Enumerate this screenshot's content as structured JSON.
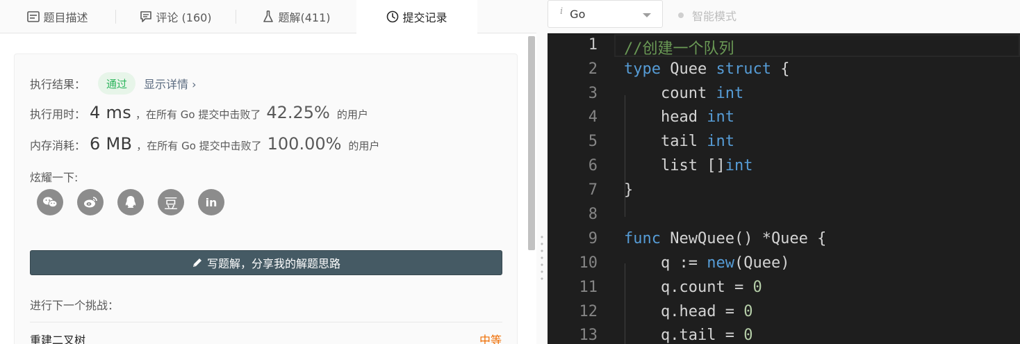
{
  "tabs": [
    {
      "label": "题目描述",
      "icon": "description-icon"
    },
    {
      "label": "评论 (160)",
      "icon": "comment-icon"
    },
    {
      "label": "题解(411)",
      "icon": "flask-icon"
    },
    {
      "label": "提交记录",
      "icon": "clock-icon",
      "active": true
    }
  ],
  "result": {
    "label": "执行结果：",
    "status": "通过",
    "detail": "显示详情 ›"
  },
  "runtime": {
    "label": "执行用时：",
    "value": "4 ms",
    "middle": "，在所有 Go 提交中击败了",
    "percent": "42.25%",
    "suffix": "的用户"
  },
  "memory": {
    "label": "内存消耗：",
    "value": "6 MB",
    "middle": "，在所有 Go 提交中击败了",
    "percent": "100.00%",
    "suffix": "的用户"
  },
  "share": {
    "label": "炫耀一下:",
    "icons": [
      "wechat-icon",
      "weibo-icon",
      "qq-icon",
      "douban-icon",
      "linkedin-icon"
    ],
    "douban_glyph": "豆",
    "linkedin_glyph": "in"
  },
  "write_solution": {
    "label": "写题解，分享我的解题思路",
    "icon": "pencil-icon"
  },
  "next_challenge": {
    "label": "进行下一个挑战：",
    "item": "重建二叉树",
    "difficulty": "中等"
  },
  "editor_toolbar": {
    "language": "Go",
    "mode_label": "智能模式"
  },
  "code_lines": [
    {
      "n": "1",
      "text": "//创建一个队列"
    },
    {
      "n": "2",
      "text": "type Quee struct {"
    },
    {
      "n": "3",
      "text": "    count int"
    },
    {
      "n": "4",
      "text": "    head int"
    },
    {
      "n": "5",
      "text": "    tail int"
    },
    {
      "n": "6",
      "text": "    list []int"
    },
    {
      "n": "7",
      "text": "}"
    },
    {
      "n": "8",
      "text": ""
    },
    {
      "n": "9",
      "text": "func NewQuee() *Quee {"
    },
    {
      "n": "10",
      "text": "    q := new(Quee)"
    },
    {
      "n": "11",
      "text": "    q.count = 0"
    },
    {
      "n": "12",
      "text": "    q.head = 0"
    },
    {
      "n": "13",
      "text": "    q.tail = 0"
    }
  ],
  "colors": {
    "accent_pass": "#2db55d",
    "button_bg": "#455a64",
    "difficulty_medium": "#ef6c00",
    "editor_bg": "#1e1e1e"
  }
}
